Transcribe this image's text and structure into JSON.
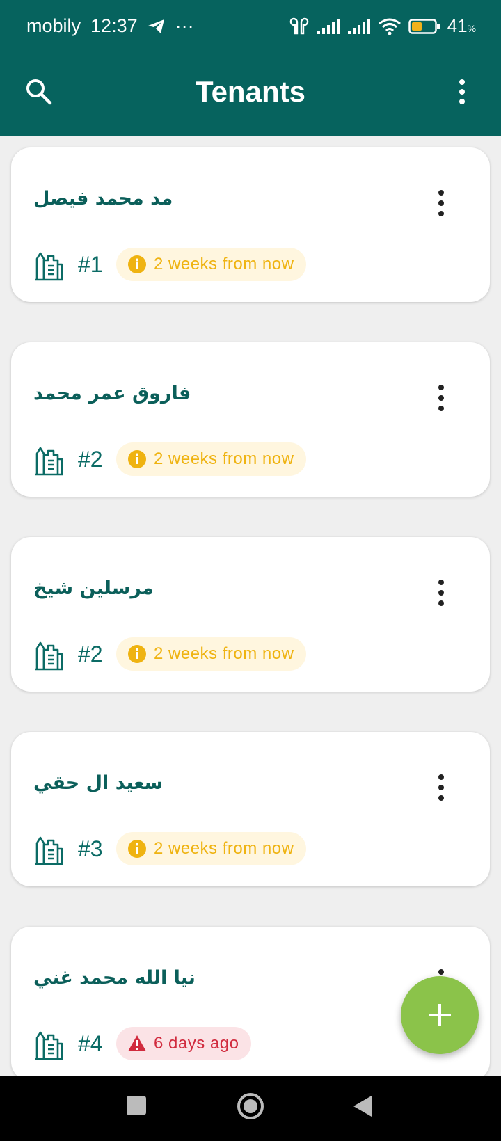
{
  "status_bar": {
    "carrier": "mobily",
    "time": "12:37",
    "more": "···",
    "battery": "41"
  },
  "app_bar": {
    "title": "Tenants"
  },
  "tenants": [
    {
      "name": "مد محمد فيصل",
      "unit": "#1",
      "due": "2 weeks from now",
      "status": "upcoming"
    },
    {
      "name": "فاروق عمر محمد",
      "unit": "#2",
      "due": "2 weeks from now",
      "status": "upcoming"
    },
    {
      "name": "مرسلين شيخ",
      "unit": "#2",
      "due": "2 weeks from now",
      "status": "upcoming"
    },
    {
      "name": "سعيد ال حقي",
      "unit": "#3",
      "due": "2 weeks from now",
      "status": "upcoming"
    },
    {
      "name": "نيا الله محمد غني",
      "unit": "#4",
      "due": "6 days ago",
      "status": "overdue"
    }
  ],
  "colors": {
    "primary": "#06635e",
    "accent": "#8bc34a",
    "warning": "#efb311",
    "danger": "#d12b3e"
  },
  "icons": {
    "search": "search-icon",
    "menu": "more-vert-icon",
    "building": "building-icon",
    "info": "info-icon",
    "alert": "warning-triangle-icon",
    "add": "plus-icon"
  }
}
